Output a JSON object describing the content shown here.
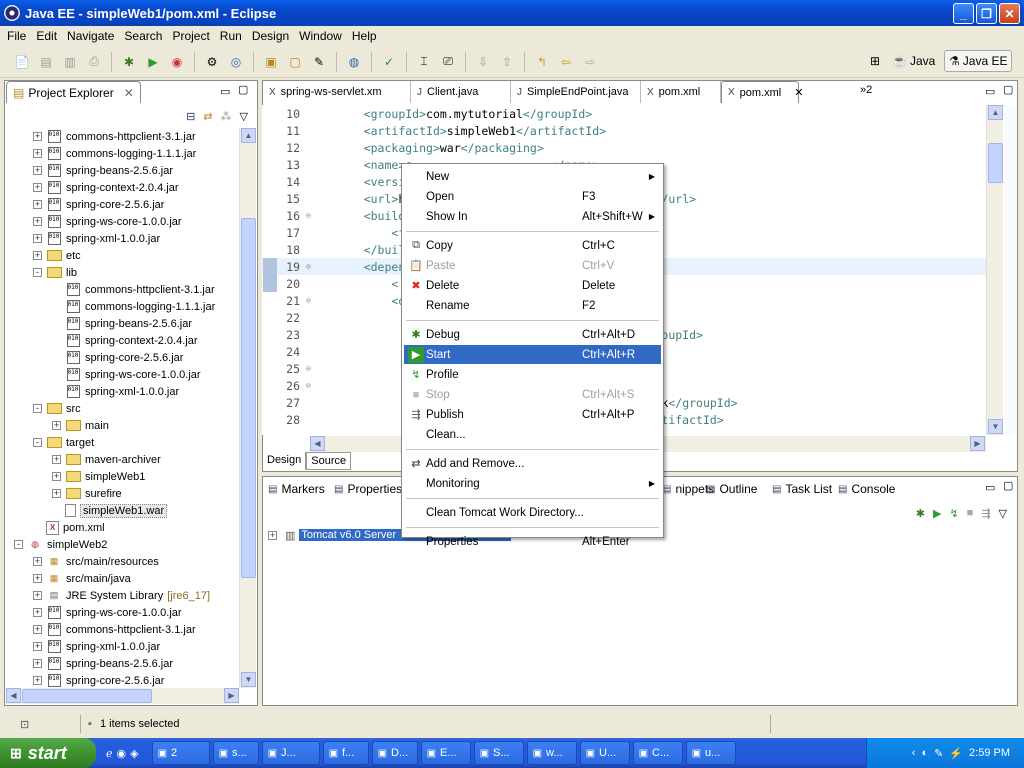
{
  "window": {
    "title": "Java EE - simpleWeb1/pom.xml - Eclipse"
  },
  "menubar": [
    "File",
    "Edit",
    "Navigate",
    "Search",
    "Project",
    "Run",
    "Design",
    "Window",
    "Help"
  ],
  "perspectives": {
    "java": "Java",
    "javaee": "Java EE"
  },
  "project_explorer": {
    "title": "Project Explorer",
    "rows": [
      {
        "indent": 1,
        "exp": "+",
        "icon": "jar",
        "label": "commons-httpclient-3.1.jar"
      },
      {
        "indent": 1,
        "exp": "+",
        "icon": "jar",
        "label": "commons-logging-1.1.1.jar"
      },
      {
        "indent": 1,
        "exp": "+",
        "icon": "jar",
        "label": "spring-beans-2.5.6.jar"
      },
      {
        "indent": 1,
        "exp": "+",
        "icon": "jar",
        "label": "spring-context-2.0.4.jar"
      },
      {
        "indent": 1,
        "exp": "+",
        "icon": "jar",
        "label": "spring-core-2.5.6.jar"
      },
      {
        "indent": 1,
        "exp": "+",
        "icon": "jar",
        "label": "spring-ws-core-1.0.0.jar"
      },
      {
        "indent": 1,
        "exp": "+",
        "icon": "jar",
        "label": "spring-xml-1.0.0.jar"
      },
      {
        "indent": 1,
        "exp": "+",
        "icon": "folder",
        "label": "etc"
      },
      {
        "indent": 1,
        "exp": "-",
        "icon": "folder",
        "label": "lib"
      },
      {
        "indent": 2,
        "exp": "",
        "icon": "jar",
        "label": "commons-httpclient-3.1.jar"
      },
      {
        "indent": 2,
        "exp": "",
        "icon": "jar",
        "label": "commons-logging-1.1.1.jar"
      },
      {
        "indent": 2,
        "exp": "",
        "icon": "jar",
        "label": "spring-beans-2.5.6.jar"
      },
      {
        "indent": 2,
        "exp": "",
        "icon": "jar",
        "label": "spring-context-2.0.4.jar"
      },
      {
        "indent": 2,
        "exp": "",
        "icon": "jar",
        "label": "spring-core-2.5.6.jar"
      },
      {
        "indent": 2,
        "exp": "",
        "icon": "jar",
        "label": "spring-ws-core-1.0.0.jar"
      },
      {
        "indent": 2,
        "exp": "",
        "icon": "jar",
        "label": "spring-xml-1.0.0.jar"
      },
      {
        "indent": 1,
        "exp": "-",
        "icon": "folder",
        "label": "src"
      },
      {
        "indent": 2,
        "exp": "+",
        "icon": "folder",
        "label": "main"
      },
      {
        "indent": 1,
        "exp": "-",
        "icon": "folder",
        "label": "target"
      },
      {
        "indent": 2,
        "exp": "+",
        "icon": "folder",
        "label": "maven-archiver"
      },
      {
        "indent": 2,
        "exp": "+",
        "icon": "folder",
        "label": "simpleWeb1"
      },
      {
        "indent": 2,
        "exp": "+",
        "icon": "folder",
        "label": "surefire"
      },
      {
        "indent": 2,
        "exp": "",
        "icon": "file",
        "label": "simpleWeb1.war",
        "selected": true
      },
      {
        "indent": 1,
        "exp": "",
        "icon": "xml",
        "label": "pom.xml"
      },
      {
        "indent": 0,
        "exp": "-",
        "icon": "project",
        "label": "simpleWeb2"
      },
      {
        "indent": 1,
        "exp": "+",
        "icon": "pkgfolder",
        "label": "src/main/resources"
      },
      {
        "indent": 1,
        "exp": "+",
        "icon": "pkgfolder",
        "label": "src/main/java"
      },
      {
        "indent": 1,
        "exp": "+",
        "icon": "lib",
        "label": "JRE System Library",
        "suffix": "[jre6_17]"
      },
      {
        "indent": 1,
        "exp": "+",
        "icon": "jar",
        "label": "spring-ws-core-1.0.0.jar"
      },
      {
        "indent": 1,
        "exp": "+",
        "icon": "jar",
        "label": "commons-httpclient-3.1.jar"
      },
      {
        "indent": 1,
        "exp": "+",
        "icon": "jar",
        "label": "spring-xml-1.0.0.jar"
      },
      {
        "indent": 1,
        "exp": "+",
        "icon": "jar",
        "label": "spring-beans-2.5.6.jar"
      },
      {
        "indent": 1,
        "exp": "+",
        "icon": "jar",
        "label": "spring-core-2.5.6.jar"
      }
    ]
  },
  "editor": {
    "tabs": [
      {
        "label": "spring-ws-servlet.xm",
        "icon": "xml-icon"
      },
      {
        "label": "Client.java",
        "icon": "java-file-icon"
      },
      {
        "label": "SimpleEndPoint.java",
        "icon": "java-file-icon"
      },
      {
        "label": "pom.xml",
        "icon": "xml-icon"
      },
      {
        "label": "pom.xml",
        "icon": "xml-icon",
        "active": true
      }
    ],
    "overflow": "»2",
    "lines": [
      {
        "n": "10",
        "pre": "    ",
        "html": [
          [
            "tag",
            "<groupId>"
          ],
          [
            "txt",
            "com.mytutorial"
          ],
          [
            "tag",
            "</groupId>"
          ]
        ]
      },
      {
        "n": "11",
        "pre": "    ",
        "html": [
          [
            "tag",
            "<artifactId>"
          ],
          [
            "txt",
            "simpleWeb1"
          ],
          [
            "tag",
            "</artifactId>"
          ]
        ]
      },
      {
        "n": "12",
        "pre": "    ",
        "html": [
          [
            "tag",
            "<packaging>"
          ],
          [
            "txt",
            "war"
          ],
          [
            "tag",
            "</packaging>"
          ]
        ]
      },
      {
        "n": "13",
        "pre": "    ",
        "html": [
          [
            "tag",
            "<name>"
          ],
          [
            "txt",
            "s"
          ],
          [
            "txt",
            "                    "
          ],
          [
            "tag",
            "</name>"
          ]
        ]
      },
      {
        "n": "14",
        "pre": "    ",
        "html": [
          [
            "tag",
            "<versio"
          ]
        ]
      },
      {
        "n": "15",
        "pre": "    ",
        "html": [
          [
            "tag",
            "<url>"
          ],
          [
            "txt",
            "ht"
          ],
          [
            "txt",
            "                              "
          ],
          [
            "txt",
            "ng-ws"
          ],
          [
            "tag",
            "</url>"
          ]
        ]
      },
      {
        "n": "16",
        "pre": "    ",
        "html": [
          [
            "tag",
            "<build>"
          ]
        ],
        "fold": true
      },
      {
        "n": "17",
        "pre": "        ",
        "html": [
          [
            "tag",
            "<fi"
          ]
        ]
      },
      {
        "n": "18",
        "pre": "    ",
        "html": [
          [
            "tag",
            "</build"
          ]
        ]
      },
      {
        "n": "19",
        "pre": "    ",
        "html": [
          [
            "tag",
            "<depend"
          ]
        ],
        "fold": true,
        "current": true
      },
      {
        "n": "20",
        "pre": "        ",
        "html": [
          [
            "tag",
            "<!-"
          ]
        ]
      },
      {
        "n": "21",
        "pre": "        ",
        "html": [
          [
            "tag",
            "<de"
          ]
        ],
        "fold": true
      },
      {
        "n": "22",
        "pre": "",
        "html": [
          [
            "txt",
            "                                            "
          ],
          [
            "tag",
            "Id>"
          ]
        ]
      },
      {
        "n": "23",
        "pre": "",
        "html": [
          [
            "txt",
            "                                            "
          ],
          [
            "tag",
            "/groupId>"
          ]
        ]
      },
      {
        "n": "24",
        "pre": "",
        "html": []
      },
      {
        "n": "25",
        "pre": "",
        "html": [],
        "fold": true
      },
      {
        "n": "26",
        "pre": "",
        "html": [],
        "fold": true
      },
      {
        "n": "27",
        "pre": "",
        "html": [
          [
            "txt",
            "                                            "
          ],
          [
            "txt",
            "work"
          ],
          [
            "tag",
            "</groupId>"
          ]
        ]
      },
      {
        "n": "28",
        "pre": "",
        "html": [
          [
            "txt",
            "                                            "
          ],
          [
            "tag",
            "/artifactId>"
          ]
        ]
      }
    ],
    "bottom_tabs": [
      "Design",
      "Source"
    ]
  },
  "context_menu": {
    "items": [
      {
        "type": "item",
        "label": "New",
        "acc": "",
        "submenu": true,
        "icon": ""
      },
      {
        "type": "item",
        "label": "Open",
        "acc": "F3",
        "icon": ""
      },
      {
        "type": "item",
        "label": "Show In",
        "acc": "Alt+Shift+W",
        "submenu": true,
        "icon": ""
      },
      {
        "type": "sep"
      },
      {
        "type": "item",
        "label": "Copy",
        "acc": "Ctrl+C",
        "icon": "copy-icon"
      },
      {
        "type": "item",
        "label": "Paste",
        "acc": "Ctrl+V",
        "icon": "paste-icon",
        "disabled": true
      },
      {
        "type": "item",
        "label": "Delete",
        "acc": "Delete",
        "icon": "delete-icon"
      },
      {
        "type": "item",
        "label": "Rename",
        "acc": "F2",
        "icon": ""
      },
      {
        "type": "sep"
      },
      {
        "type": "item",
        "label": "Debug",
        "acc": "Ctrl+Alt+D",
        "icon": "debug-icon"
      },
      {
        "type": "item",
        "label": "Start",
        "acc": "Ctrl+Alt+R",
        "icon": "start-icon",
        "selected": true
      },
      {
        "type": "item",
        "label": "Profile",
        "acc": "",
        "icon": "profile-icon"
      },
      {
        "type": "item",
        "label": "Stop",
        "acc": "Ctrl+Alt+S",
        "icon": "stop-icon",
        "disabled": true
      },
      {
        "type": "item",
        "label": "Publish",
        "acc": "Ctrl+Alt+P",
        "icon": "publish-icon"
      },
      {
        "type": "item",
        "label": "Clean...",
        "acc": "",
        "icon": ""
      },
      {
        "type": "sep"
      },
      {
        "type": "item",
        "label": "Add and Remove...",
        "acc": "",
        "icon": "add-remove-icon"
      },
      {
        "type": "item",
        "label": "Monitoring",
        "acc": "",
        "submenu": true,
        "icon": ""
      },
      {
        "type": "sep"
      },
      {
        "type": "item",
        "label": "Clean Tomcat Work Directory...",
        "acc": "",
        "icon": ""
      },
      {
        "type": "sep"
      },
      {
        "type": "item",
        "label": "Properties",
        "acc": "Alt+Enter",
        "icon": ""
      }
    ]
  },
  "bottom_panel": {
    "tabs": [
      {
        "label": "Markers",
        "icon": "markers-icon"
      },
      {
        "label": "Properties",
        "icon": "properties-icon"
      },
      {
        "label": "nippets",
        "icon": "snippets-icon"
      },
      {
        "label": "Outline",
        "icon": "outline-icon"
      },
      {
        "label": "Task List",
        "icon": "task-list-icon"
      },
      {
        "label": "Console",
        "icon": "console-icon"
      }
    ],
    "server": "Tomcat v6.0 Server"
  },
  "status": {
    "text": "1 items selected"
  },
  "taskbar": {
    "start": "start",
    "buttons": [
      {
        "label": "2",
        "icon": "ie-icon",
        "w": 58
      },
      {
        "label": "s...",
        "icon": "excel-icon",
        "w": 46
      },
      {
        "label": "J...",
        "icon": "eclipse-icon",
        "w": 58
      },
      {
        "label": "f...",
        "icon": "pdf-icon",
        "w": 46
      },
      {
        "label": "D...",
        "icon": "browser-icon",
        "w": 46
      },
      {
        "label": "E...",
        "icon": "network-icon",
        "w": 50
      },
      {
        "label": "S...",
        "icon": "word-icon",
        "w": 50
      },
      {
        "label": "w...",
        "icon": "folder-icon",
        "w": 50
      },
      {
        "label": "U...",
        "icon": "doc-icon",
        "w": 50
      },
      {
        "label": "C...",
        "icon": "cmd-icon",
        "w": 50
      },
      {
        "label": "u...",
        "icon": "app-icon",
        "w": 50
      }
    ],
    "clock": "2:59 PM"
  }
}
